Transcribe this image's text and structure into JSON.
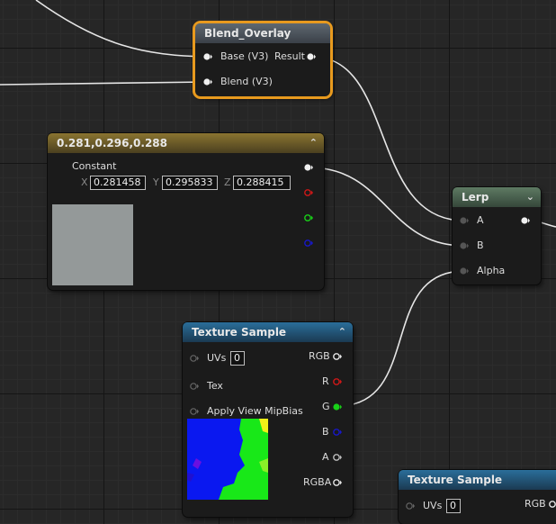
{
  "nodes": {
    "blend_overlay": {
      "title": "Blend_Overlay",
      "inputs": [
        "Base (V3)",
        "Blend (V3)"
      ],
      "output": "Result"
    },
    "constant": {
      "title": "0.281,0.296,0.288",
      "label": "Constant",
      "axes": [
        "X",
        "Y",
        "Z"
      ],
      "values": [
        "0.281458",
        "0.295833",
        "0.288415"
      ],
      "swatch_color": "#949999"
    },
    "lerp": {
      "title": "Lerp",
      "inputs": [
        "A",
        "B",
        "Alpha"
      ]
    },
    "texture_sample_1": {
      "title": "Texture Sample",
      "inputs": [
        "UVs",
        "Tex",
        "Apply View MipBias"
      ],
      "uv_value": "0",
      "outputs": [
        "RGB",
        "R",
        "G",
        "B",
        "A",
        "RGBA"
      ]
    },
    "texture_sample_2": {
      "title": "Texture Sample",
      "inputs": [
        "UVs"
      ],
      "uv_value": "0",
      "outputs": [
        "RGB"
      ]
    }
  },
  "colors": {
    "selection": "#e89a1e",
    "pin_red": "#d01818",
    "pin_green": "#18d018",
    "pin_blue": "#1818c8",
    "wire": "#e6e6e6"
  }
}
